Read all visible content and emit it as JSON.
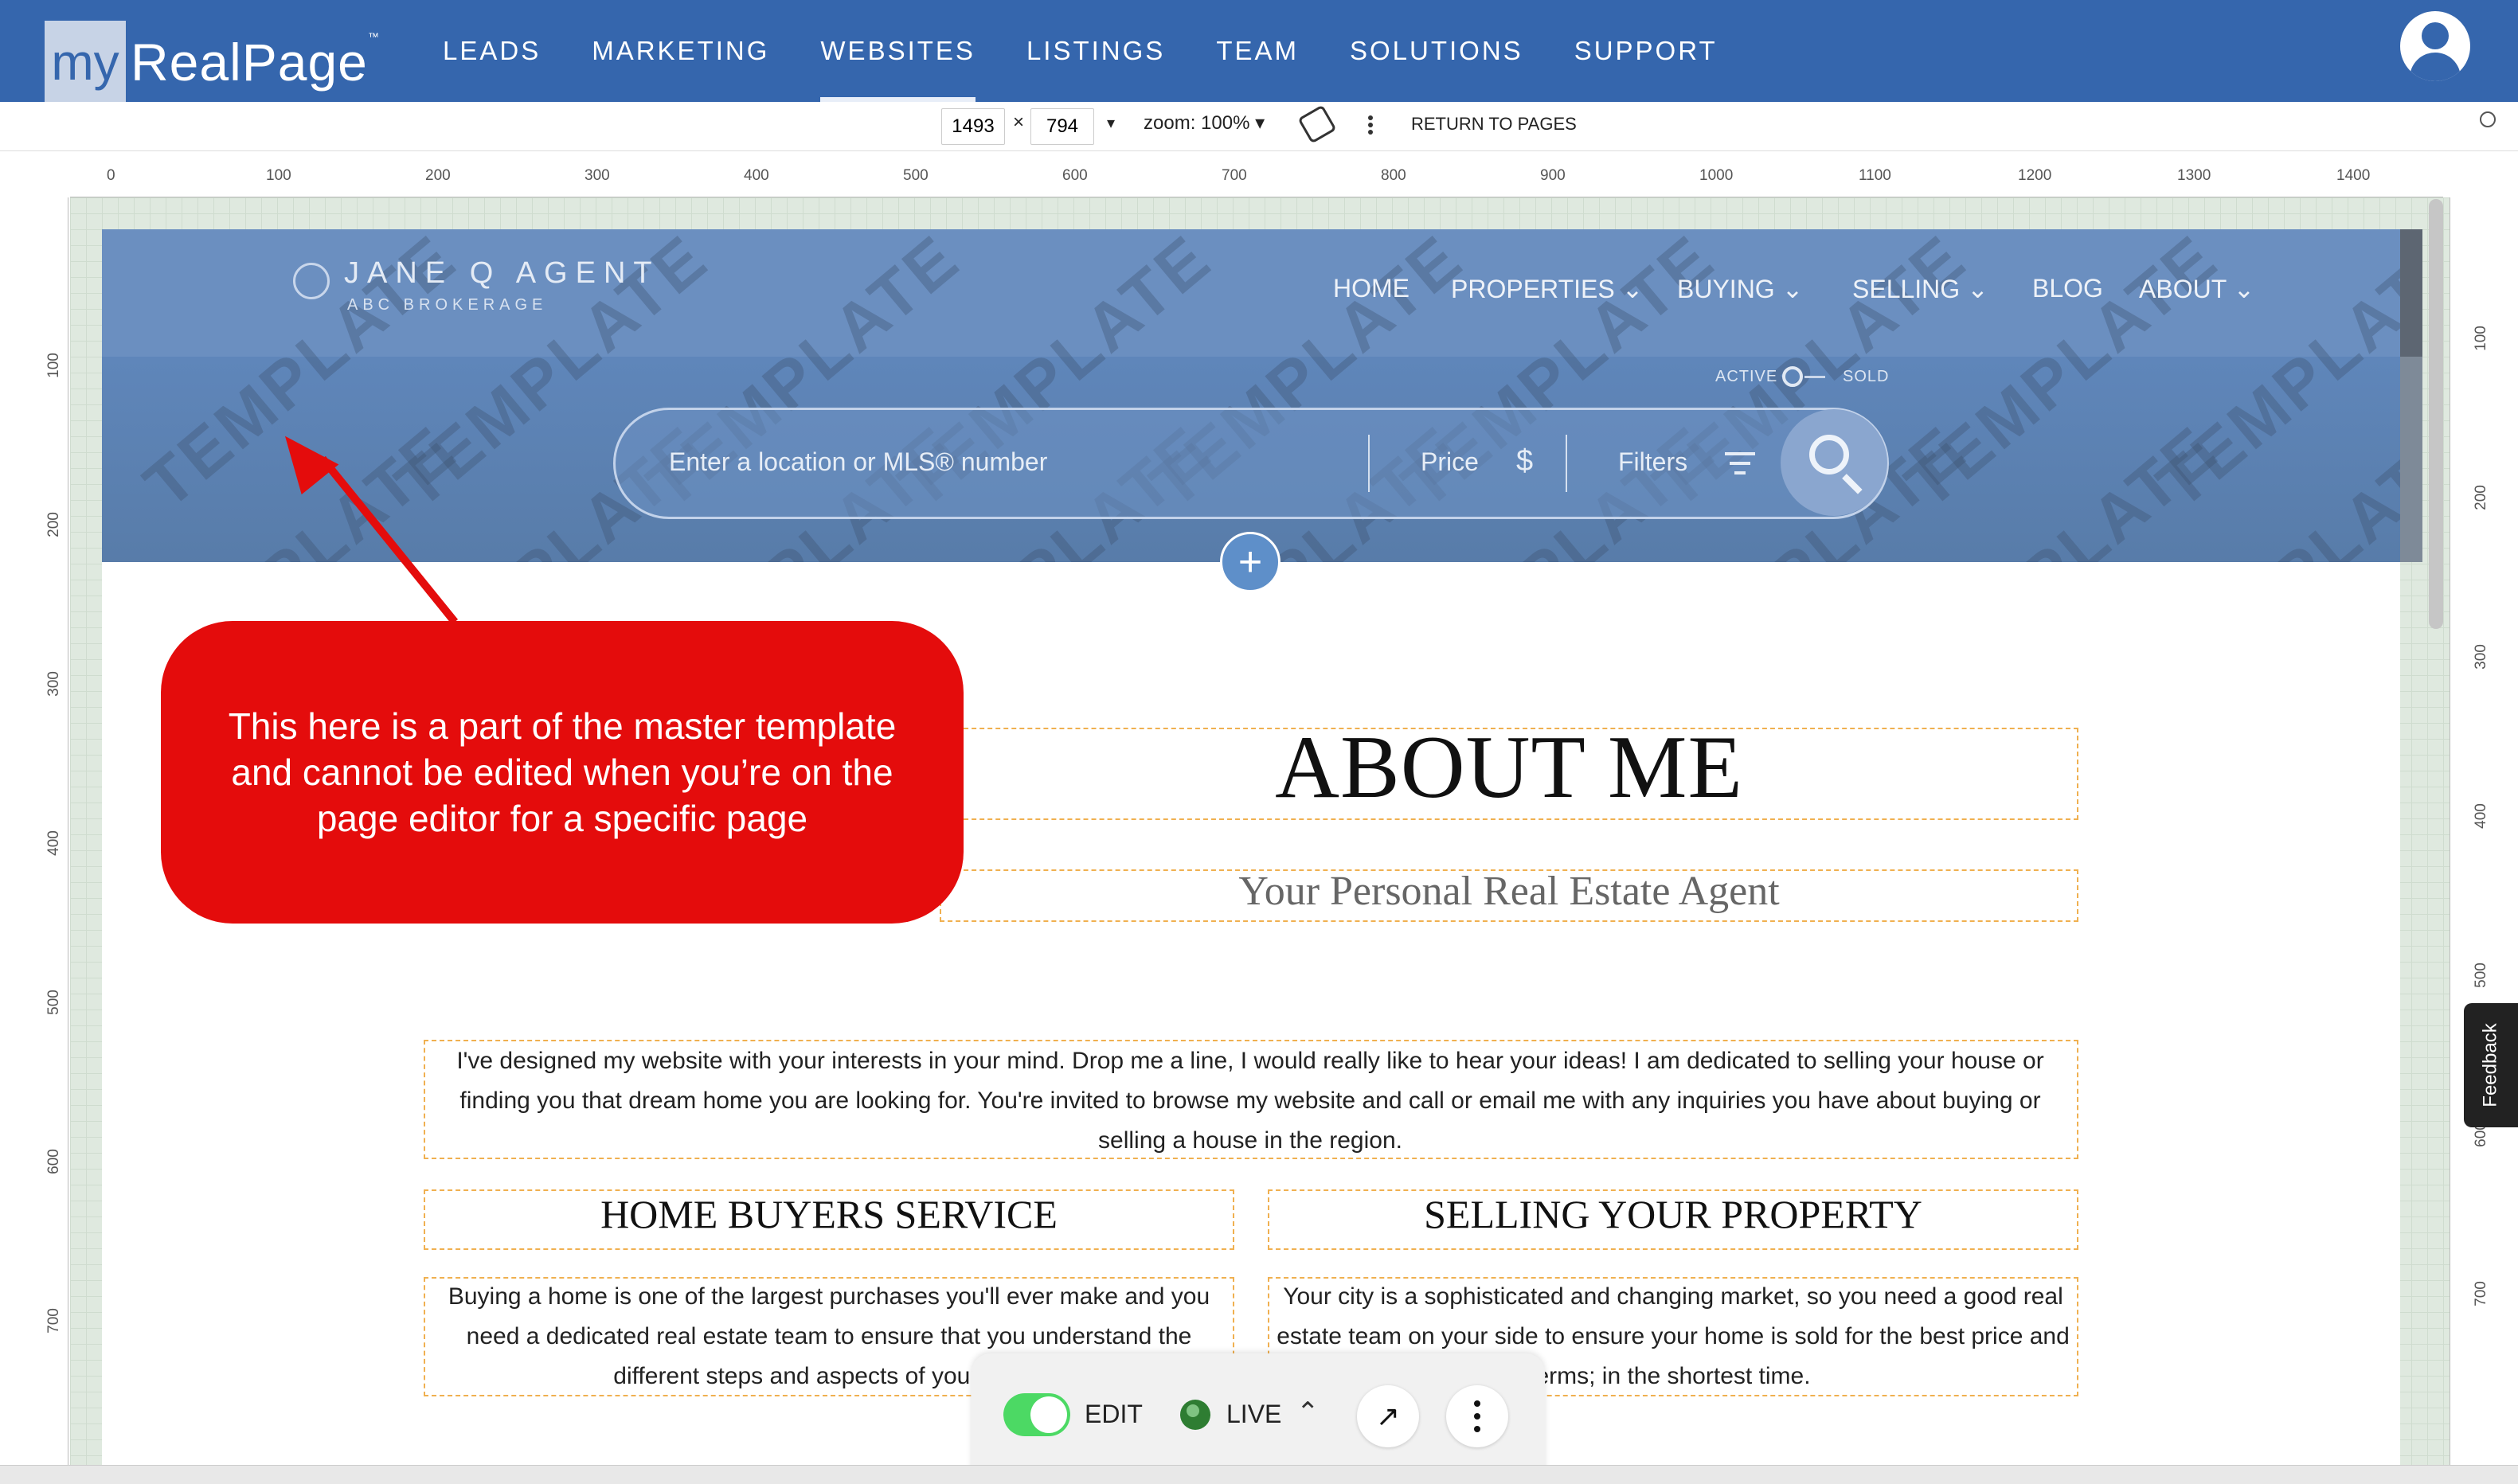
{
  "app": {
    "logo_my": "my",
    "logo_name": "RealPage",
    "logo_tm": "™",
    "nav": [
      "LEADS",
      "MARKETING",
      "WEBSITES",
      "LISTINGS",
      "TEAM",
      "SOLUTIONS",
      "SUPPORT"
    ],
    "active_nav": "WEBSITES",
    "brand_color": "#3566ad"
  },
  "toolbar": {
    "width_value": "1493",
    "times": "×",
    "height_value": "794",
    "zoom": "zoom: 100%",
    "return_label": "RETURN TO PAGES"
  },
  "ruler": {
    "top_ticks": [
      "0",
      "100",
      "200",
      "300",
      "400",
      "500",
      "600",
      "700",
      "800",
      "900",
      "1000",
      "1100",
      "1200",
      "1300",
      "1400"
    ],
    "left_ticks": [
      "100",
      "200",
      "300",
      "400",
      "500",
      "600",
      "700"
    ],
    "right_ticks": [
      "100",
      "200",
      "300",
      "400",
      "500",
      "600",
      "700"
    ]
  },
  "site": {
    "agent_name": "JANE Q AGENT",
    "brokerage": "ABC BROKERAGE",
    "watermark": "TEMPLATE",
    "nav": {
      "home": "HOME",
      "properties": "PROPERTIES",
      "buying": "BUYING",
      "selling": "SELLING",
      "blog": "BLOG",
      "about": "ABOUT"
    },
    "toggle_active": "ACTIVE",
    "toggle_sold": "SOLD",
    "search_placeholder": "Enter a location or MLS® number",
    "price_label": "Price",
    "price_symbol": "$",
    "filters_label": "Filters",
    "add_symbol": "+"
  },
  "content": {
    "title": "ABOUT ME",
    "subtitle": "Your Personal Real Estate Agent",
    "intro": "I've designed my website with your interests in your mind. Drop me a line, I would really like to hear your ideas! I am dedicated to selling your house or finding you that dream home you are looking for. You're invited to browse my website and call or email me with any inquiries you have about buying or selling a house in the region.",
    "col1_title": "HOME BUYERS SERVICE",
    "col1_text": "Buying a home is one of the largest purchases you'll ever make and you need a dedicated real estate team to ensure that you understand the different steps and aspects of your purch",
    "col2_title": "SELLING YOUR PROPERTY",
    "col2_text": "Your city is a sophisticated and changing market, so you need a good real estate team on your side to ensure your home is sold for the best price and erms; in the shortest time."
  },
  "callout": {
    "text": "This here is a part of the master template and cannot be edited when you’re on the page editor for a specific page",
    "color": "#e40c0c"
  },
  "bottom_bar": {
    "edit_label": "EDIT",
    "edit_on": true,
    "live_label": "LIVE",
    "chevron": "^",
    "open_icon": "↗"
  },
  "feedback_label": "Feedback"
}
